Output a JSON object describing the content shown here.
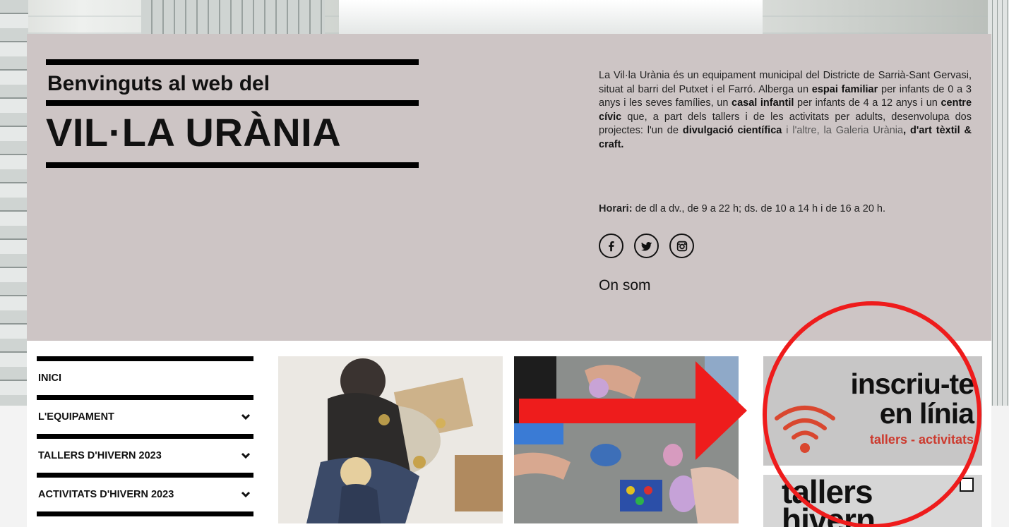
{
  "hero": {
    "welcome": "Benvinguts al web del",
    "site_name": "VIL·LA URÀNIA",
    "intro": {
      "p1": "La Vil·la Urània és un equipament municipal del Districte de Sarrià-Sant Gervasi, situat al barri del Putxet i el Farró. Alberga un ",
      "b1": "espai familiar",
      "p2": " per infants de 0 a 3 anys i les seves famílies, un ",
      "b2": "casal infantil",
      "p3": " per infants de 4 a 12 anys i un ",
      "b3": "centre cívic",
      "p4": " que, a part dels tallers i de les activitats per adults, desenvolupa dos projectes: l'un de ",
      "b4": "divulgació científica",
      "p5": " i l'altre, la Galeria Urània",
      "b5": ", d'art tèxtil & craft."
    },
    "hours_label": "Horari:",
    "hours_text": " de dl a dv., de 9 a 22 h; ds. de 10 a 14 h i de 16 a 20 h.",
    "social_icons": [
      "facebook-icon",
      "twitter-icon",
      "instagram-icon"
    ],
    "location_link": "On som"
  },
  "nav": {
    "items": [
      {
        "label": "INICI"
      },
      {
        "label": "L'EQUIPAMENT"
      },
      {
        "label": "TALLERS D'HIVERN 2023"
      },
      {
        "label": "ACTIVITATS D'HIVERN 2023"
      }
    ]
  },
  "banners": {
    "signup_line1": "inscriu-te",
    "signup_line2": "en línia",
    "signup_sub": "tallers - activitats",
    "second_text": "tallers\nhivern"
  },
  "colors": {
    "hero_bg": "#cdc5c5",
    "annotation_red": "#ee1c1c",
    "banner_red": "#cc3a2e"
  }
}
